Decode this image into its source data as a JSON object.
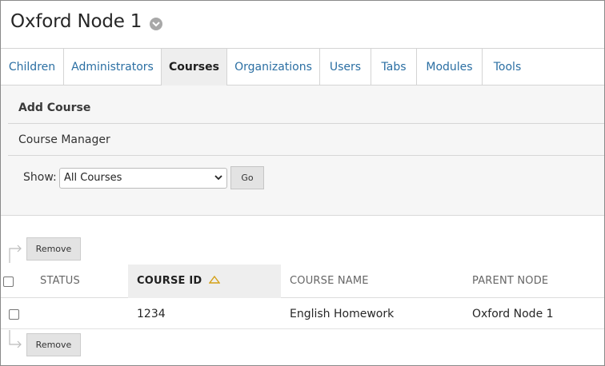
{
  "header": {
    "title": "Oxford Node 1"
  },
  "tabs": [
    {
      "label": "Children",
      "active": false
    },
    {
      "label": "Administrators",
      "active": false
    },
    {
      "label": "Courses",
      "active": true
    },
    {
      "label": "Organizations",
      "active": false
    },
    {
      "label": "Users",
      "active": false
    },
    {
      "label": "Tabs",
      "active": false
    },
    {
      "label": "Modules",
      "active": false
    },
    {
      "label": "Tools",
      "active": false
    }
  ],
  "actions": {
    "add_course": "Add Course",
    "course_manager": "Course Manager"
  },
  "filter": {
    "label": "Show:",
    "selected": "All Courses",
    "go_label": "Go"
  },
  "bulk": {
    "remove_label": "Remove"
  },
  "table": {
    "columns": [
      "STATUS",
      "COURSE ID",
      "COURSE NAME",
      "PARENT NODE"
    ],
    "sorted_column": "COURSE ID",
    "rows": [
      {
        "status": "",
        "course_id": "1234",
        "course_name": "English Homework",
        "parent_node": "Oxford Node 1"
      }
    ]
  },
  "colors": {
    "link": "#2b6fa3",
    "active_tab_bg": "#eeeeee",
    "panel_bg": "#f6f6f6",
    "sort_icon": "#d4a017"
  }
}
